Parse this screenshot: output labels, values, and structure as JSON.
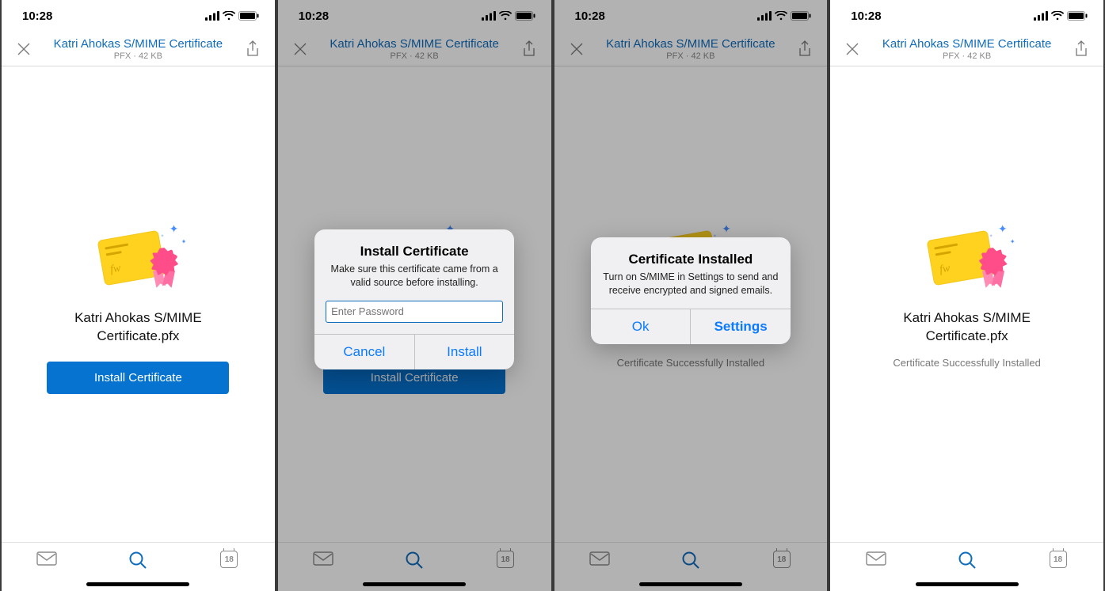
{
  "status": {
    "time": "10:28"
  },
  "header": {
    "title": "Katri Ahokas S/MIME Certificate",
    "subtitle": "PFX · 42 KB"
  },
  "cert": {
    "filename_line1": "Katri Ahokas S/MIME",
    "filename_line2": "Certificate.pfx",
    "install_button": "Install Certificate",
    "success_message": "Certificate Successfully Installed"
  },
  "install_dialog": {
    "title": "Install Certificate",
    "message": "Make sure this certificate came from a valid source before installing.",
    "placeholder": "Enter Password",
    "cancel": "Cancel",
    "confirm": "Install"
  },
  "installed_dialog": {
    "title": "Certificate Installed",
    "message": "Turn on S/MIME in Settings to send and receive encrypted and signed emails.",
    "ok": "Ok",
    "settings": "Settings"
  },
  "tabbar": {
    "calendar_day": "18"
  }
}
